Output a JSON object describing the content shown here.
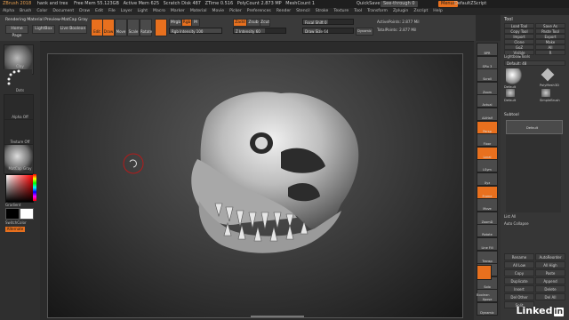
{
  "titlebar": {
    "app": "ZBrush 2018",
    "file": "hank and trex",
    "free_mem": "Free Mem 55.123GB",
    "active_mem": "Active Mem 625",
    "scratch": "Scratch Disk 487",
    "ztime": "ZTime 0.516",
    "polycount": "PolyCount 2.873 MP",
    "meshcount": "MeshCount 1",
    "quicksave": "QuickSave",
    "see_through": "See-through 0",
    "menus": "Menus",
    "default_script": "DefaultZScript"
  },
  "menubar": [
    "Alpha",
    "Brush",
    "Color",
    "Document",
    "Draw",
    "Edit",
    "File",
    "Layer",
    "Light",
    "Macro",
    "Marker",
    "Material",
    "Movie",
    "Picker",
    "Preferences",
    "Render",
    "Stencil",
    "Stroke",
    "Texture",
    "Tool",
    "Transform",
    "Zplugin",
    "Zscript",
    "Help"
  ],
  "shelf": {
    "status": "Rendering Material Preview-MatCap Gray",
    "home_page": "Home Page",
    "lightbox": "LightBox",
    "live_boolean": "Live Boolean",
    "edit": "Edit",
    "draw": "Draw",
    "move": "Move",
    "scale": "Scale",
    "rotate": "Rotate",
    "mrgb": "Mrgb",
    "rgb": "Rgb",
    "m": "M",
    "zadd": "Zadd",
    "zsub": "Zsub",
    "zcut": "Zcut",
    "rgb_intensity": "Rgb Intensity 100",
    "z_intensity": "Z Intensity 60",
    "focal_shift": "Focal Shift 0",
    "draw_size": "Draw Size 64",
    "dynamic": "Dynamic",
    "active_points": "ActivePoints: 2.877 Mil",
    "total_points": "TotalPoints: 2.877 Mil"
  },
  "lefttray": {
    "brush1": "Clay",
    "brush2": "Dots",
    "alpha": "Alpha Off",
    "texture": "Texture Off",
    "material": "MatCap Gray",
    "gradient": "Gradient",
    "switch_color": "SwitchColor",
    "alternate": "Alternate"
  },
  "rightstrip": [
    "BPR",
    "SPix 3",
    "Scroll",
    "Zoom",
    "Actual",
    "AAHalf",
    "Persp",
    "Floor",
    "Local",
    "LSym",
    "Xyz",
    "Frame",
    "Move",
    "ZoomD",
    "Rotate",
    "Line Fill",
    "Transp",
    "Ghost",
    "Solo",
    "Xpose",
    "Dynamic"
  ],
  "rightpanel": {
    "title": "Tool",
    "buttons": [
      "Load Tool",
      "Save As",
      "Copy Tool",
      "Paste Tool",
      "Import",
      "Export",
      "Clone",
      "Make PolyMesh3D",
      "GoZ",
      "All",
      "Visible",
      "R"
    ],
    "lightbox_tools": "Lightbox▸Tools",
    "default_value": "Default: 48",
    "tool_names": [
      "Default",
      "PolyMesh3D",
      "Default",
      "SimpleBrush"
    ],
    "subtool": "Subtool",
    "subtool_item": "Default",
    "list_all": "List All",
    "auto_collapse": "Auto Collapse",
    "actions": [
      "Rename",
      "AutoReorder",
      "All Low",
      "All High",
      "Copy",
      "Paste",
      "Duplicate",
      "Append",
      "Insert",
      "Delete",
      "Del Other",
      "Del All",
      "Split"
    ],
    "boolean": "Boolean"
  },
  "watermark": "Linked"
}
